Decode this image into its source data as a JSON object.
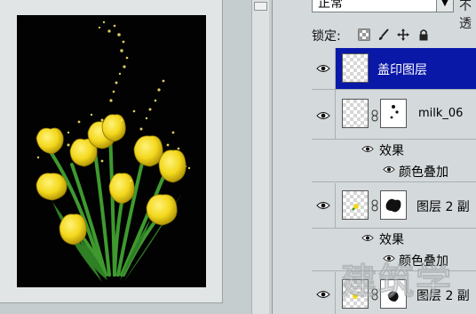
{
  "layers_panel": {
    "blend_mode": "正常",
    "opacity_label": "不透",
    "lock_label": "锁定:",
    "lock_icons": [
      "lock-transparent-icon",
      "lock-brush-icon",
      "lock-move-icon",
      "lock-all-icon"
    ],
    "layers": [
      {
        "name": "盖印图层",
        "selected": true,
        "has_mask": false
      },
      {
        "name": "milk_06",
        "selected": false,
        "has_mask": true,
        "effects_label": "效果",
        "effects": [
          "颜色叠加"
        ]
      },
      {
        "name": "图层 2 副",
        "selected": false,
        "has_mask": true,
        "effects_label": "效果",
        "effects": [
          "颜色叠加"
        ]
      },
      {
        "name": "图层 2 副",
        "selected": false,
        "has_mask": true
      }
    ]
  },
  "watermark": {
    "text": "建筑学"
  },
  "colors": {
    "selected_row": "#0a18a8",
    "tulip": "#f3d81c",
    "stem": "#3e9a2e",
    "canvas_bg": "#020202"
  }
}
